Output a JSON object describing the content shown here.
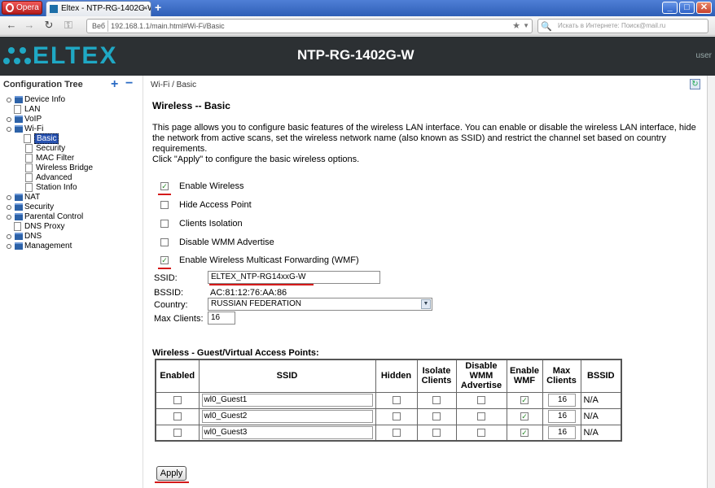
{
  "browser": {
    "app_button": "Opera",
    "tab_title": "Eltex - NTP-RG-1402G-W",
    "address_badge": "Веб",
    "url": "192.168.1.1/main.html#Wi-Fi/Basic",
    "search_placeholder": "Искать в Интернете: Поиск@mail.ru",
    "win_min": "_",
    "win_max": "□",
    "win_close": "✕",
    "new_tab": "+"
  },
  "header": {
    "logo_text": "ELTEX",
    "model": "NTP-RG-1402G-W",
    "user": "user"
  },
  "sidebar": {
    "title": "Configuration Tree",
    "add": "+",
    "remove": "−",
    "items": [
      {
        "label": "Device Info"
      },
      {
        "label": "LAN"
      },
      {
        "label": "VoIP"
      },
      {
        "label": "Wi-Fi"
      },
      {
        "label": "Basic"
      },
      {
        "label": "Security"
      },
      {
        "label": "MAC Filter"
      },
      {
        "label": "Wireless Bridge"
      },
      {
        "label": "Advanced"
      },
      {
        "label": "Station Info"
      },
      {
        "label": "NAT"
      },
      {
        "label": "Security"
      },
      {
        "label": "Parental Control"
      },
      {
        "label": "DNS Proxy"
      },
      {
        "label": "DNS"
      },
      {
        "label": "Management"
      }
    ]
  },
  "main": {
    "breadcrumb": "Wi-Fi / Basic",
    "title": "Wireless -- Basic",
    "description_1": "This page allows you to configure basic features of the wireless LAN interface. You can enable or disable the wireless LAN interface, hide the network from active scans, set the wireless network name (also known as SSID) and restrict the channel set based on country requirements.",
    "description_2": "Click \"Apply\" to configure the basic wireless options.",
    "options": [
      {
        "label": "Enable Wireless",
        "checked": true
      },
      {
        "label": "Hide Access Point",
        "checked": false
      },
      {
        "label": "Clients Isolation",
        "checked": false
      },
      {
        "label": "Disable WMM Advertise",
        "checked": false
      },
      {
        "label": "Enable Wireless Multicast Forwarding (WMF)",
        "checked": true
      }
    ],
    "ssid_label": "SSID:",
    "ssid_value": "ELTEX_NTP-RG14xxG-W",
    "bssid_label": "BSSID:",
    "bssid_value": "AC:81:12:76:AA:86",
    "country_label": "Country:",
    "country_value": "RUSSIAN FEDERATION",
    "max_clients_label": "Max Clients:",
    "max_clients_value": "16",
    "guest_title": "Wireless - Guest/Virtual Access Points:",
    "table": {
      "headers": [
        "Enabled",
        "SSID",
        "Hidden",
        "Isolate Clients",
        "Disable WMM Advertise",
        "Enable WMF",
        "Max Clients",
        "BSSID"
      ],
      "rows": [
        {
          "ssid": "wl0_Guest1",
          "max": "16",
          "bssid": "N/A",
          "enabled": false,
          "hidden": false,
          "isolate": false,
          "wmm": false,
          "wmf": true
        },
        {
          "ssid": "wl0_Guest2",
          "max": "16",
          "bssid": "N/A",
          "enabled": false,
          "hidden": false,
          "isolate": false,
          "wmm": false,
          "wmf": true
        },
        {
          "ssid": "wl0_Guest3",
          "max": "16",
          "bssid": "N/A",
          "enabled": false,
          "hidden": false,
          "isolate": false,
          "wmm": false,
          "wmf": true
        }
      ]
    },
    "apply_label": "Apply"
  },
  "icons": {
    "back": "back-arrow-icon",
    "forward": "forward-arrow-icon",
    "reload": "reload-icon",
    "key": "key-icon",
    "star": "star-icon",
    "refresh": "refresh-icon"
  },
  "colors": {
    "header_bg": "#2c3033",
    "logo": "#1fa8c4",
    "selection": "#2852b0",
    "annotation_red": "#d41a1a"
  }
}
